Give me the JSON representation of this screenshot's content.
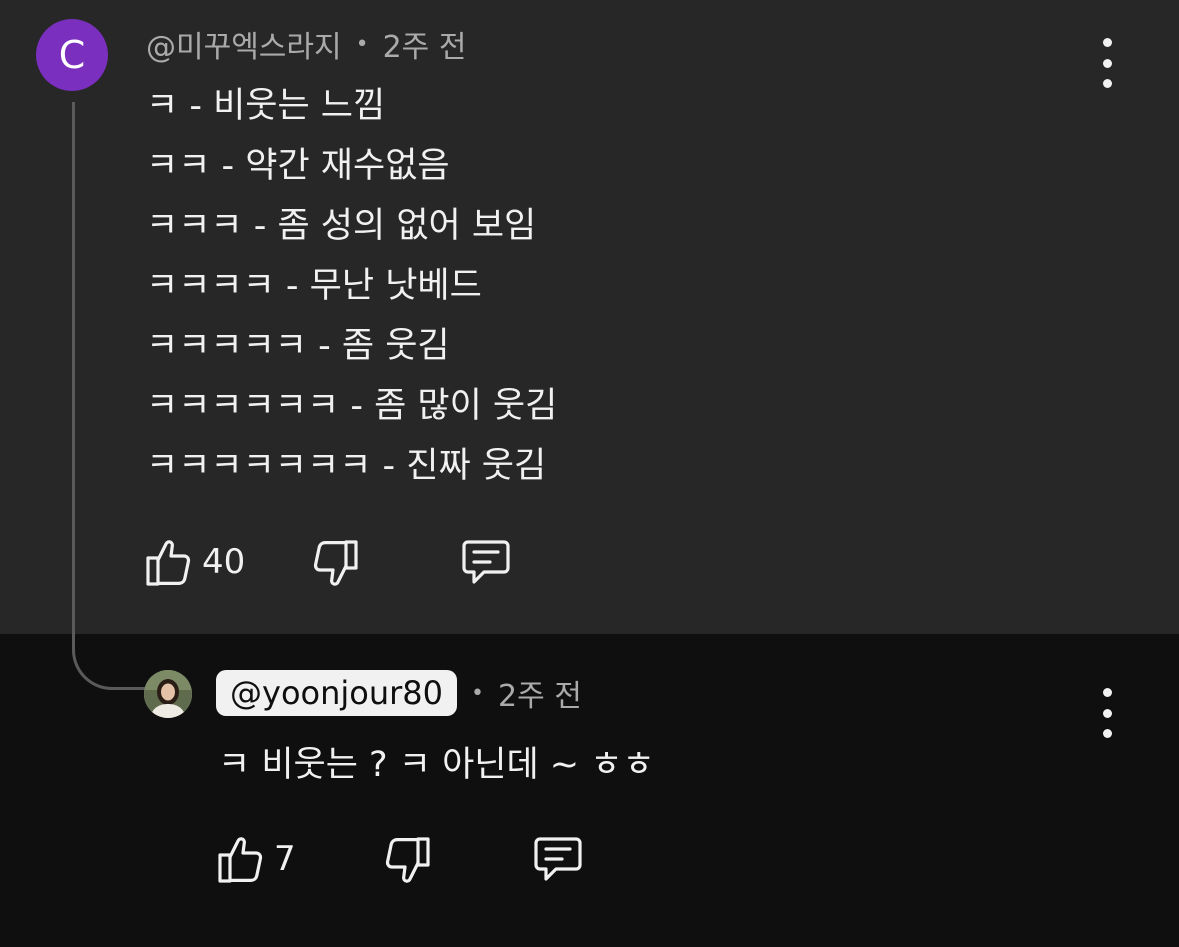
{
  "comment": {
    "avatar_letter": "C",
    "author": "@미꾸엑스라지",
    "separator": "•",
    "time": "2주 전",
    "lines": [
      "ㅋ - 비웃는 느낌",
      "ㅋㅋ - 약간 재수없음",
      "ㅋㅋㅋ - 좀 성의 없어 보임",
      "ㅋㅋㅋㅋ - 무난 낫베드",
      "ㅋㅋㅋㅋㅋ - 좀 웃김",
      "ㅋㅋㅋㅋㅋㅋ - 좀 많이 웃김",
      "ㅋㅋㅋㅋㅋㅋㅋ - 진짜 웃김"
    ],
    "like_count": "40",
    "colors": {
      "background": "#272727",
      "avatar": "#7b2fbe",
      "meta_text": "#aaaaaa"
    },
    "icons": [
      "thumbs-up-icon",
      "thumbs-down-icon",
      "reply-icon",
      "more-vert-icon"
    ]
  },
  "reply": {
    "author": "@yoonjour80",
    "separator": "•",
    "time": "2주 전",
    "text": "ㅋ 비웃는 ? ㅋ 아닌데 ~ ㅎㅎ",
    "like_count": "7",
    "colors": {
      "background": "#0f0f0f",
      "handle_pill": "#f1f1f1"
    },
    "icons": [
      "thumbs-up-icon",
      "thumbs-down-icon",
      "reply-icon",
      "more-vert-icon"
    ]
  }
}
